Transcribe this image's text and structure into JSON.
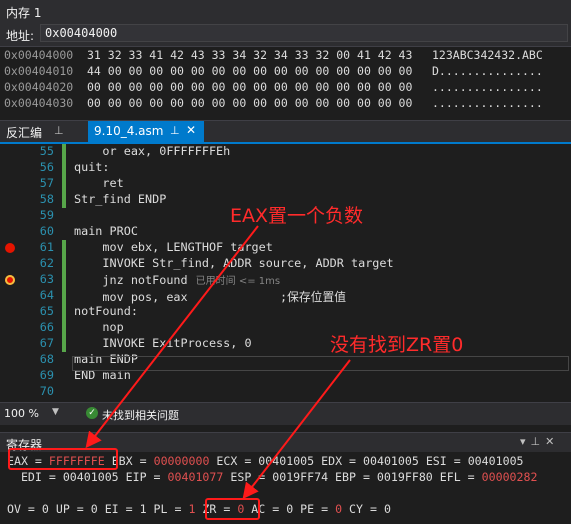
{
  "memory": {
    "title": "内存 1",
    "address_label": "地址:",
    "address_value": "0x00404000",
    "rows": [
      {
        "addr": "0x00404000",
        "bytes": "31 32 33 41 42 43 33 34 32 34 33 32 00 41 42 43",
        "ascii": "123ABC342432.ABC"
      },
      {
        "addr": "0x00404010",
        "bytes": "44 00 00 00 00 00 00 00 00 00 00 00 00 00 00 00",
        "ascii": "D..............."
      },
      {
        "addr": "0x00404020",
        "bytes": "00 00 00 00 00 00 00 00 00 00 00 00 00 00 00 00",
        "ascii": "................"
      },
      {
        "addr": "0x00404030",
        "bytes": "00 00 00 00 00 00 00 00 00 00 00 00 00 00 00 00",
        "ascii": "................"
      }
    ]
  },
  "tabs": {
    "disasm_label": "反汇编",
    "pin_glyph": "⊥",
    "file_label": "9.10_4.asm",
    "close_glyph": "✕"
  },
  "editor": {
    "lines": [
      {
        "num": "55",
        "text": "    or eax, 0FFFFFFFEh"
      },
      {
        "num": "56",
        "text": "quit:"
      },
      {
        "num": "57",
        "text": "    ret"
      },
      {
        "num": "58",
        "text": "Str_find ENDP"
      },
      {
        "num": "59",
        "text": ""
      },
      {
        "num": "60",
        "text": "main PROC"
      },
      {
        "num": "61",
        "text": "    mov ebx, LENGTHOF target"
      },
      {
        "num": "62",
        "text": "    INVOKE Str_find, ADDR source, ADDR target"
      },
      {
        "num": "63",
        "text": "    jnz notFound"
      },
      {
        "num": "64",
        "text": "    mov pos, eax             ;保存位置值"
      },
      {
        "num": "65",
        "text": "notFound:"
      },
      {
        "num": "66",
        "text": "    nop"
      },
      {
        "num": "67",
        "text": "    INVOKE ExitProcess, 0"
      },
      {
        "num": "68",
        "text": "main ENDP"
      },
      {
        "num": "69",
        "text": "END main"
      },
      {
        "num": "70",
        "text": ""
      }
    ],
    "time_hint": "已用时间 <= 1ms"
  },
  "status": {
    "zoom": "100 %",
    "message": "未找到相关问题"
  },
  "registers": {
    "title": "寄存器",
    "line1_a": " EAX = ",
    "eax": "FFFFFFFE",
    "line1_b": " EBX = ",
    "ebx": "00000000",
    "line1_c": " ECX = 00401005 EDX = 00401005 ESI = 00401005",
    "line2_a": "   EDI = 00401005 EIP = ",
    "eip": "00401077",
    "line2_b": " ESP = 0019FF74 EBP = 0019FF80 EFL = ",
    "efl": "00000282",
    "line3_a": " OV = 0 UP = 0 EI = 1 PL = ",
    "pl": "1",
    "line3_b": " ZR = ",
    "zr": "0",
    "line3_c": " AC = 0 PE = ",
    "pe": "0",
    "line3_d": " CY = 0"
  },
  "annotations": {
    "eax_note": "EAX置一个负数",
    "zr_note": "没有找到ZR置0",
    "color": "#ff1a1a"
  },
  "colors": {
    "accent": "#007acc",
    "breakpoint": "#e51400",
    "line_number": "#2b91af",
    "changed_value": "#e05050"
  }
}
